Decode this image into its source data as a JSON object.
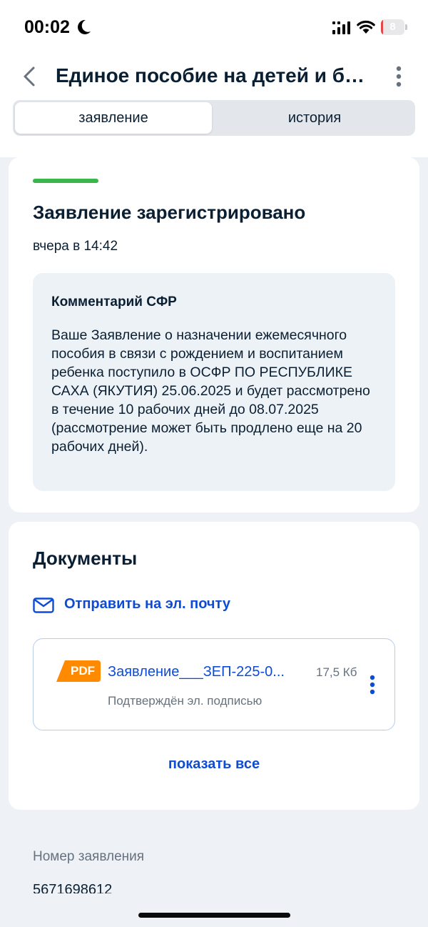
{
  "status_bar": {
    "time": "00:02",
    "battery_level": "8",
    "battery_percent": 8,
    "battery_color": "#e64646"
  },
  "header": {
    "title": "Единое пособие на детей и бе...",
    "back_icon": "chevron-left-icon",
    "menu_icon": "more-vertical-icon"
  },
  "tabs": [
    {
      "label": "заявление",
      "active": true
    },
    {
      "label": "история",
      "active": false
    }
  ],
  "status_card": {
    "title": "Заявление зарегистрировано",
    "time": "вчера в 14:42",
    "status_color": "#3cb54a",
    "comment": {
      "title": "Комментарий СФР",
      "text": "Ваше Заявление о назначении ежемесячного пособия в связи с рождением и воспитанием ребенка поступило в ОСФР ПО РЕСПУБЛИКЕ САХА (ЯКУТИЯ) 25.06.2025 и будет рассмотрено в течение 10 рабочих дней до 08.07.2025 (рассмотрение может быть продлено еще на 20 рабочих дней)."
    }
  },
  "documents": {
    "title": "Документы",
    "send_email_label": "Отправить на эл. почту",
    "files": [
      {
        "type_label": "PDF",
        "name": "Заявление___ЗЕП-225-0...",
        "size": "17,5 Кб",
        "signature": "Подтверждён эл. подписью"
      }
    ],
    "show_all_label": "показать все"
  },
  "application_number": {
    "label": "Номер заявления",
    "value": "5671698612"
  },
  "colors": {
    "accent": "#0d4cd3",
    "pdf_badge": "#ff8a00",
    "background": "#eef1f5"
  }
}
